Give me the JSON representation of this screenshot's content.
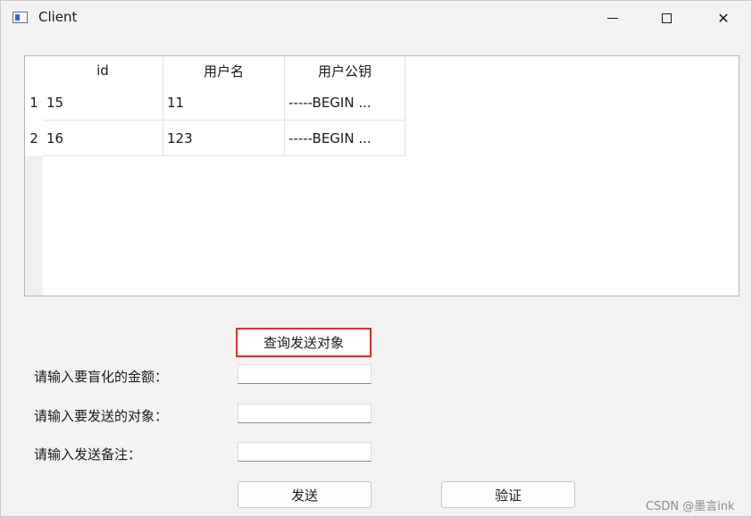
{
  "window": {
    "title": "Client",
    "minimize_icon": "minimize-icon",
    "maximize_icon": "maximize-icon",
    "close_glyph": "✕"
  },
  "table": {
    "columns": [
      "id",
      "用户名",
      "用户公钥"
    ],
    "row_numbers": [
      "1",
      "2"
    ],
    "rows": [
      [
        "15",
        "11",
        "-----BEGIN ..."
      ],
      [
        "16",
        "123",
        "-----BEGIN ..."
      ]
    ]
  },
  "form": {
    "query_button": "查询发送对象",
    "amount_label": "请输入要盲化的金额：",
    "amount_value": "",
    "target_label": "请输入要发送的对象：",
    "target_value": "",
    "note_label": "请输入发送备注：",
    "note_value": "",
    "send_button": "发送",
    "verify_button": "验证"
  },
  "watermark": "CSDN @墨言ink"
}
